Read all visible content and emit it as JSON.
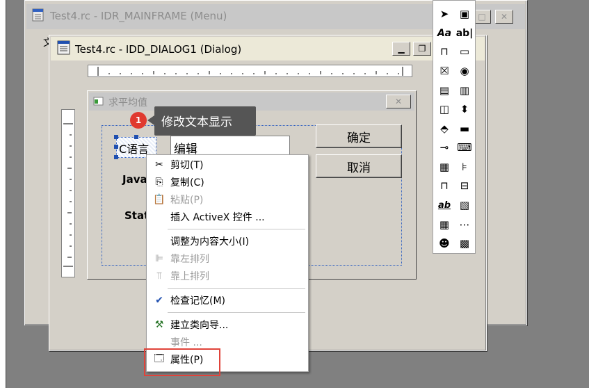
{
  "menu_window": {
    "title": "Test4.rc - IDR_MAINFRAME (Menu)",
    "partial_text": "文"
  },
  "dialog_window": {
    "title": "Test4.rc - IDD_DIALOG1 (Dialog)"
  },
  "form": {
    "title": "求平均值",
    "ok_label": "确定",
    "cancel_label": "取消",
    "selected_static": "C语言",
    "static_java": "Java",
    "static_stati": "Stati",
    "edit_text": "编辑"
  },
  "tooltip": {
    "badge": "1",
    "text": "修改文本显示"
  },
  "context_menu": {
    "cut": "剪切(T)",
    "copy": "复制(C)",
    "paste": "粘贴(P)",
    "insert_activex": "插入 ActiveX 控件 ...",
    "resize": "调整为内容大小(I)",
    "align_left": "靠左排列",
    "align_top": "靠上排列",
    "check_mnemonics": "检查记忆(M)",
    "class_wizard": "建立类向导...",
    "events": "事件 ...",
    "properties": "属性(P)"
  },
  "toolbox": {
    "tools": [
      "pointer-tool",
      "picture-tool",
      "static-text-tool",
      "edit-box-tool",
      "group-box-tool",
      "button-tool",
      "checkbox-tool",
      "radio-tool",
      "combo-box-tool",
      "list-box-tool",
      "hscroll-tool",
      "vscroll-tool",
      "spin-tool",
      "progress-tool",
      "slider-tool",
      "hotkey-tool",
      "list-control-tool",
      "tree-control-tool",
      "tab-control-tool",
      "animate-tool",
      "rich-edit-tool",
      "date-time-tool",
      "month-calendar-tool",
      "ip-address-tool",
      "custom-control-tool",
      "extended-combo-tool"
    ],
    "static_glyph": "Aa",
    "edit_glyph": "ab|",
    "rich_glyph": "ab"
  },
  "accent": "#e03a2f"
}
